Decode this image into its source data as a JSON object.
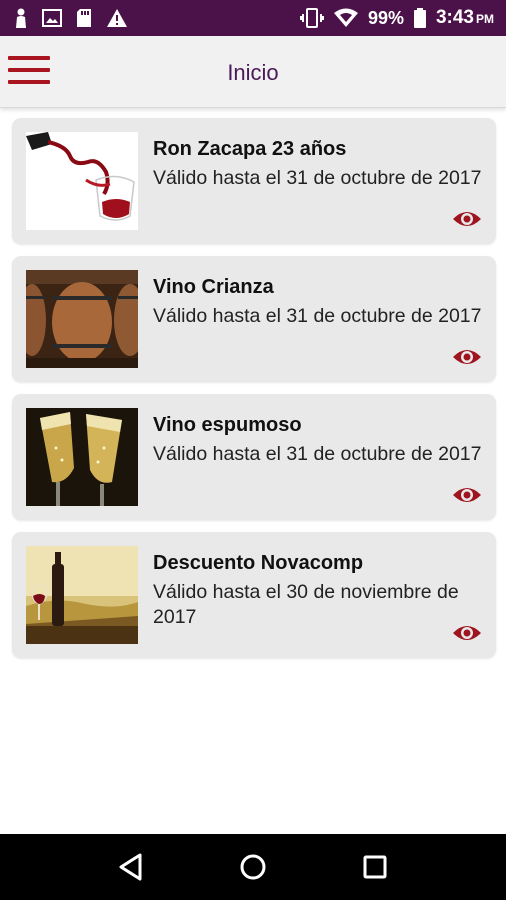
{
  "status_bar": {
    "battery_percent": "99%",
    "time": "3:43",
    "ampm": "PM",
    "icons_left": [
      "notification-person-icon",
      "image-icon",
      "sd-card-icon",
      "warning-icon"
    ],
    "icons_right": [
      "vibrate-icon",
      "wifi-icon",
      "battery-icon"
    ]
  },
  "app_bar": {
    "title": "Inicio",
    "menu_icon": "hamburger-menu-icon",
    "accent_color": "#a8151f",
    "title_color": "#4b1a59"
  },
  "offers": [
    {
      "title": "Ron Zacapa 23 años",
      "validity": "Válido hasta el 31 de octubre de 2017",
      "image": "wine-pour-glass",
      "action_icon": "eye-icon"
    },
    {
      "title": "Vino Crianza",
      "validity": "Válido hasta el 31 de octubre de 2017",
      "image": "wine-barrels",
      "action_icon": "eye-icon"
    },
    {
      "title": "Vino espumoso",
      "validity": "Válido hasta el 31 de octubre de 2017",
      "image": "champagne-flutes",
      "action_icon": "eye-icon"
    },
    {
      "title": "Descuento Novacomp",
      "validity": "Válido hasta el 30 de noviembre de 2017",
      "image": "wine-bottle-vineyard",
      "action_icon": "eye-icon"
    }
  ],
  "nav_bar": {
    "buttons": [
      "back-triangle-icon",
      "home-circle-icon",
      "recents-square-icon"
    ]
  },
  "colors": {
    "status_bar_bg": "#4b1249",
    "card_bg": "#e9e9e9",
    "eye_icon": "#9e1520"
  }
}
